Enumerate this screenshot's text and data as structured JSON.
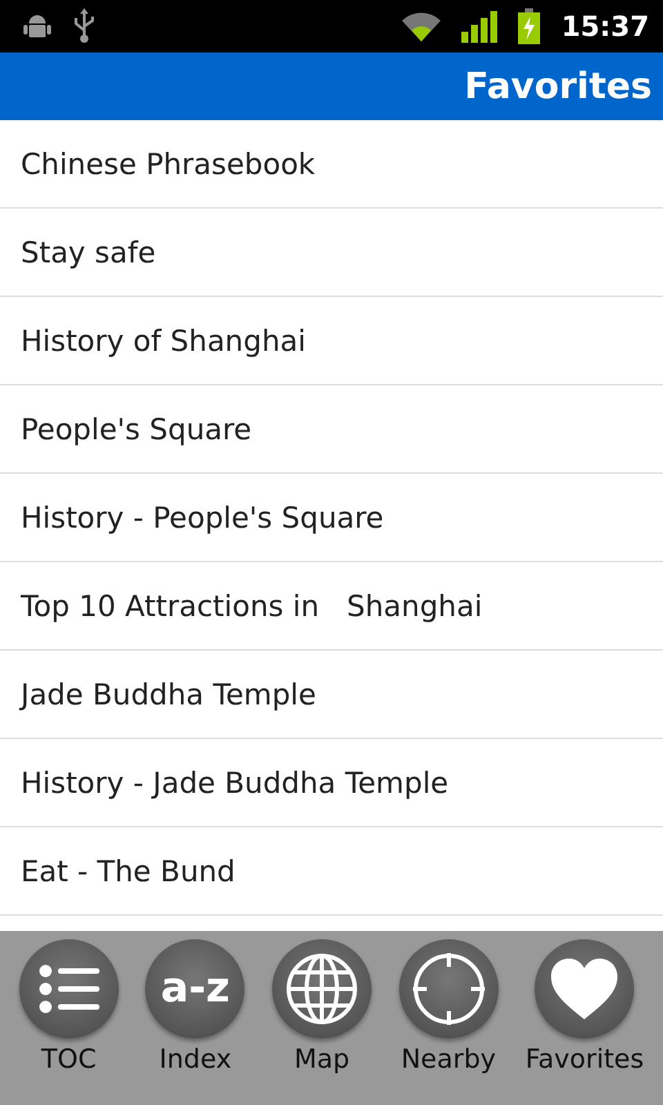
{
  "status_bar": {
    "time": "15:37"
  },
  "title_bar": {
    "title": "Favorites"
  },
  "favorites": [
    {
      "label": "Chinese Phrasebook"
    },
    {
      "label": "Stay safe"
    },
    {
      "label": "History of Shanghai"
    },
    {
      "label": "People's Square"
    },
    {
      "label": "History - People's Square"
    },
    {
      "label": "Top 10 Attractions in   Shanghai"
    },
    {
      "label": "Jade Buddha Temple"
    },
    {
      "label": "History - Jade Buddha Temple"
    },
    {
      "label": "Eat - The Bund"
    }
  ],
  "nav": [
    {
      "kind": "toc",
      "label": "TOC"
    },
    {
      "kind": "index",
      "label": "Index",
      "icon_text": "a-z"
    },
    {
      "kind": "map",
      "label": "Map"
    },
    {
      "kind": "nearby",
      "label": "Nearby"
    },
    {
      "kind": "favorites",
      "label": "Favorites"
    }
  ]
}
